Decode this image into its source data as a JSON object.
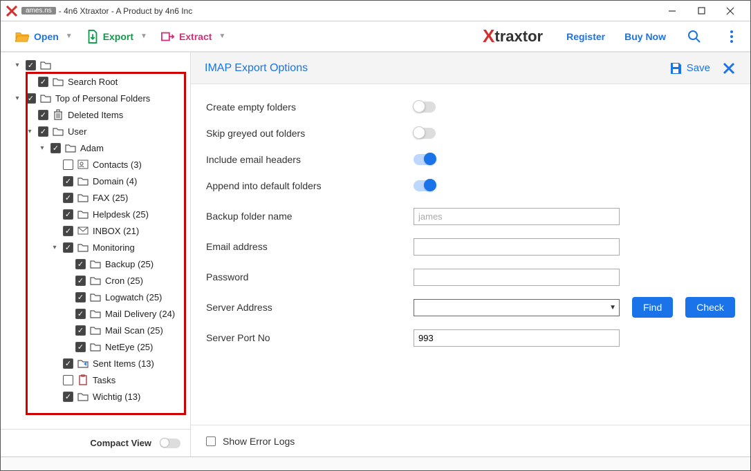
{
  "title": "- 4n6 Xtraxtor - A Product by 4n6 Inc",
  "file_tag": "ames.ns",
  "menu": {
    "open": "Open",
    "export": "Export",
    "extract": "Extract"
  },
  "brand": {
    "name": "traxtor",
    "register": "Register",
    "buy": "Buy Now"
  },
  "tree": [
    {
      "d": 0,
      "t": "",
      "tog": "▾",
      "chk": true,
      "ico": "folder"
    },
    {
      "d": 1,
      "t": "Search Root",
      "tog": "",
      "chk": true,
      "ico": "folder"
    },
    {
      "d": 0,
      "t": "Top of Personal Folders",
      "tog": "▾",
      "chk": true,
      "ico": "folder"
    },
    {
      "d": 1,
      "t": "Deleted Items",
      "tog": "",
      "chk": true,
      "ico": "trash"
    },
    {
      "d": 1,
      "t": "User",
      "tog": "▾",
      "chk": true,
      "ico": "folder"
    },
    {
      "d": 2,
      "t": "Adam",
      "tog": "▾",
      "chk": true,
      "ico": "folder"
    },
    {
      "d": 3,
      "t": "Contacts  (3)",
      "tog": "",
      "chk": false,
      "ico": "contacts"
    },
    {
      "d": 3,
      "t": "Domain  (4)",
      "tog": "",
      "chk": true,
      "ico": "folder"
    },
    {
      "d": 3,
      "t": "FAX  (25)",
      "tog": "",
      "chk": true,
      "ico": "folder"
    },
    {
      "d": 3,
      "t": "Helpdesk  (25)",
      "tog": "",
      "chk": true,
      "ico": "folder"
    },
    {
      "d": 3,
      "t": "INBOX  (21)",
      "tog": "",
      "chk": true,
      "ico": "inbox"
    },
    {
      "d": 3,
      "t": "Monitoring",
      "tog": "▾",
      "chk": true,
      "ico": "folder"
    },
    {
      "d": 4,
      "t": "Backup  (25)",
      "tog": "",
      "chk": true,
      "ico": "folder"
    },
    {
      "d": 4,
      "t": "Cron  (25)",
      "tog": "",
      "chk": true,
      "ico": "folder"
    },
    {
      "d": 4,
      "t": "Logwatch  (25)",
      "tog": "",
      "chk": true,
      "ico": "folder"
    },
    {
      "d": 4,
      "t": "Mail Delivery  (24)",
      "tog": "",
      "chk": true,
      "ico": "folder"
    },
    {
      "d": 4,
      "t": "Mail Scan  (25)",
      "tog": "",
      "chk": true,
      "ico": "folder"
    },
    {
      "d": 4,
      "t": "NetEye  (25)",
      "tog": "",
      "chk": true,
      "ico": "folder"
    },
    {
      "d": 3,
      "t": "Sent Items  (13)",
      "tog": "",
      "chk": true,
      "ico": "sent"
    },
    {
      "d": 3,
      "t": "Tasks",
      "tog": "",
      "chk": false,
      "ico": "tasks"
    },
    {
      "d": 3,
      "t": "Wichtig  (13)",
      "tog": "",
      "chk": true,
      "ico": "folder"
    }
  ],
  "compact": "Compact View",
  "panel": {
    "title": "IMAP Export Options",
    "save": "Save",
    "toggles": [
      {
        "label": "Create empty folders",
        "on": false
      },
      {
        "label": "Skip greyed out folders",
        "on": false
      },
      {
        "label": "Include email headers",
        "on": true
      },
      {
        "label": "Append into default folders",
        "on": true
      }
    ],
    "fields": {
      "backup_label": "Backup folder name",
      "backup_ph": "james",
      "email_label": "Email address",
      "pw_label": "Password",
      "server_label": "Server Address",
      "port_label": "Server Port No",
      "port_val": "993"
    },
    "find": "Find",
    "check": "Check",
    "footer": "Show Error Logs"
  }
}
